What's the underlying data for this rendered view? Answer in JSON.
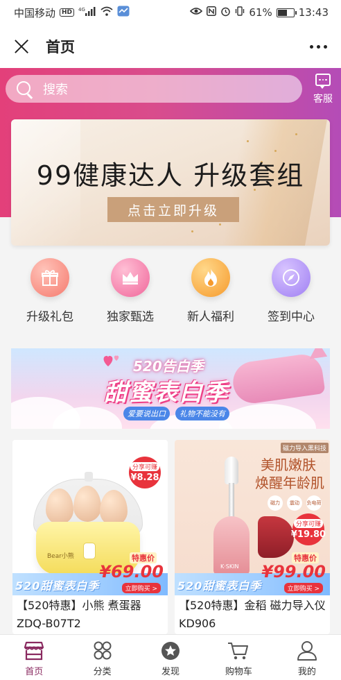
{
  "status_bar": {
    "carrier": "中国移动",
    "hd": "HD",
    "signal": "4G",
    "battery_percent": 61,
    "battery_text": "61%",
    "time": "13:43"
  },
  "title_bar": {
    "title": "首页"
  },
  "header": {
    "search_placeholder": "搜索",
    "service_label": "客服"
  },
  "banner": {
    "title": "99健康达人 升级套组",
    "button": "点击立即升级"
  },
  "quick_entries": [
    {
      "label": "升级礼包",
      "icon": "gift-icon"
    },
    {
      "label": "独家甄选",
      "icon": "crown-icon"
    },
    {
      "label": "新人福利",
      "icon": "fire-icon"
    },
    {
      "label": "签到中心",
      "icon": "compass-icon"
    }
  ],
  "promo": {
    "top": "520告白季",
    "title": "甜蜜表白季",
    "sub1": "爱要说出口",
    "sub2": "礼物不能没有"
  },
  "products": [
    {
      "title": "【520特惠】小熊 煮蛋器ZDQ-B07T2",
      "share_label": "分享可赚",
      "share_value": "¥8.28",
      "strip_text": "520甜蜜表白季",
      "deal_label": "特惠价",
      "deal_price": "¥69.00",
      "deal_button": "立即购买 >",
      "brand": "Bear小熊"
    },
    {
      "title": "【520特惠】金稻 磁力导入仪KD906",
      "share_label": "分享可赚",
      "share_value": "¥19.80",
      "strip_text": "520甜蜜表白季",
      "deal_label": "特惠价",
      "deal_price": "¥99.00",
      "deal_button": "立即购买 >",
      "tag": "磁力导入黑科技",
      "headline1": "美肌嫩肤",
      "headline2": "焕醒年龄肌",
      "features": [
        "磁力",
        "震动",
        "负电荷"
      ],
      "brand": "K·SKIN"
    }
  ],
  "tabbar": [
    {
      "label": "首页",
      "icon": "home-store-icon",
      "active": true
    },
    {
      "label": "分类",
      "icon": "category-icon",
      "active": false
    },
    {
      "label": "发现",
      "icon": "discover-star-icon",
      "active": false
    },
    {
      "label": "购物车",
      "icon": "cart-icon",
      "active": false
    },
    {
      "label": "我的",
      "icon": "user-icon",
      "active": false
    }
  ],
  "colors": {
    "header_gradient_start": "#e3407a",
    "header_gradient_end": "#b44cb7",
    "price_red": "#e8333c",
    "active_tab": "#8a2a60"
  }
}
